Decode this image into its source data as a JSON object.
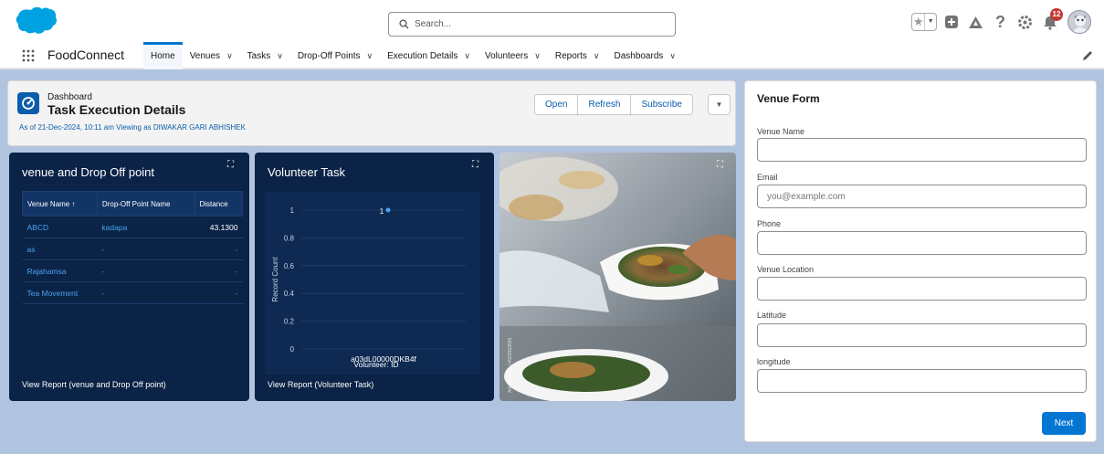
{
  "header": {
    "search_placeholder": "Search...",
    "notifications_count": "12"
  },
  "nav": {
    "app_name": "FoodConnect",
    "items": [
      {
        "label": "Home",
        "has_menu": false,
        "active": true
      },
      {
        "label": "Venues",
        "has_menu": true
      },
      {
        "label": "Tasks",
        "has_menu": true
      },
      {
        "label": "Drop-Off Points",
        "has_menu": true
      },
      {
        "label": "Execution Details",
        "has_menu": true
      },
      {
        "label": "Volunteers",
        "has_menu": true
      },
      {
        "label": "Reports",
        "has_menu": true
      },
      {
        "label": "Dashboards",
        "has_menu": true
      }
    ]
  },
  "dashboard": {
    "subtitle": "Dashboard",
    "title": "Task Execution Details",
    "as_of": "As of 21-Dec-2024, 10:11 am Viewing as DIWAKAR GARI ABHISHEK",
    "buttons": {
      "open": "Open",
      "refresh": "Refresh",
      "subscribe": "Subscribe"
    }
  },
  "venue_panel": {
    "title": "venue and Drop Off point",
    "columns": [
      "Venue Name ↑",
      "Drop-Off Point Name",
      "Distance"
    ],
    "rows": [
      [
        "ABCD",
        "kadapa",
        "43.1300"
      ],
      [
        "as",
        "-",
        "-"
      ],
      [
        "Rajahamsa",
        "-",
        "-"
      ],
      [
        "Tea Movement",
        "-",
        "-"
      ]
    ],
    "footer": "View Report (venue and Drop Off point)"
  },
  "volunteer_panel": {
    "title": "Volunteer Task",
    "footer": "View Report (Volunteer Task)"
  },
  "chart_data": {
    "type": "scatter",
    "title": "Volunteer Task",
    "xlabel": "Volunteer: ID",
    "ylabel": "Record Count",
    "categories": [
      "a03dL00000DKB4f"
    ],
    "values": [
      1
    ],
    "data_labels": [
      "1"
    ],
    "ylim": [
      0,
      1
    ],
    "yticks": [
      "0",
      "0.2",
      "0.4",
      "0.6",
      "0.8",
      "1"
    ],
    "grid": true
  },
  "photo": {
    "watermark": "Adobe Stock | #503553559"
  },
  "form": {
    "title": "Venue Form",
    "fields": {
      "venue_name": {
        "label": "Venue Name",
        "value": "",
        "placeholder": ""
      },
      "email": {
        "label": "Email",
        "value": "",
        "placeholder": "you@example.com"
      },
      "phone": {
        "label": "Phone",
        "value": "",
        "placeholder": ""
      },
      "venue_location": {
        "label": "Venue Location",
        "value": "",
        "placeholder": ""
      },
      "latitude": {
        "label": "Latitude",
        "value": "",
        "placeholder": ""
      },
      "longitude": {
        "label": "longitude",
        "value": "",
        "placeholder": ""
      }
    },
    "next_label": "Next"
  },
  "colors": {
    "brand": "#0176d3",
    "panel_bg": "#0a2346",
    "page_bg": "#b0c4df",
    "badge": "#c23934"
  },
  "icons": [
    "salesforce-cloud-logo",
    "search-icon",
    "star-icon",
    "add-icon",
    "trailhead-icon",
    "help-icon",
    "gear-icon",
    "bell-icon",
    "avatar",
    "app-launcher-icon",
    "pencil-icon",
    "dashboard-icon",
    "expand-icon"
  ]
}
